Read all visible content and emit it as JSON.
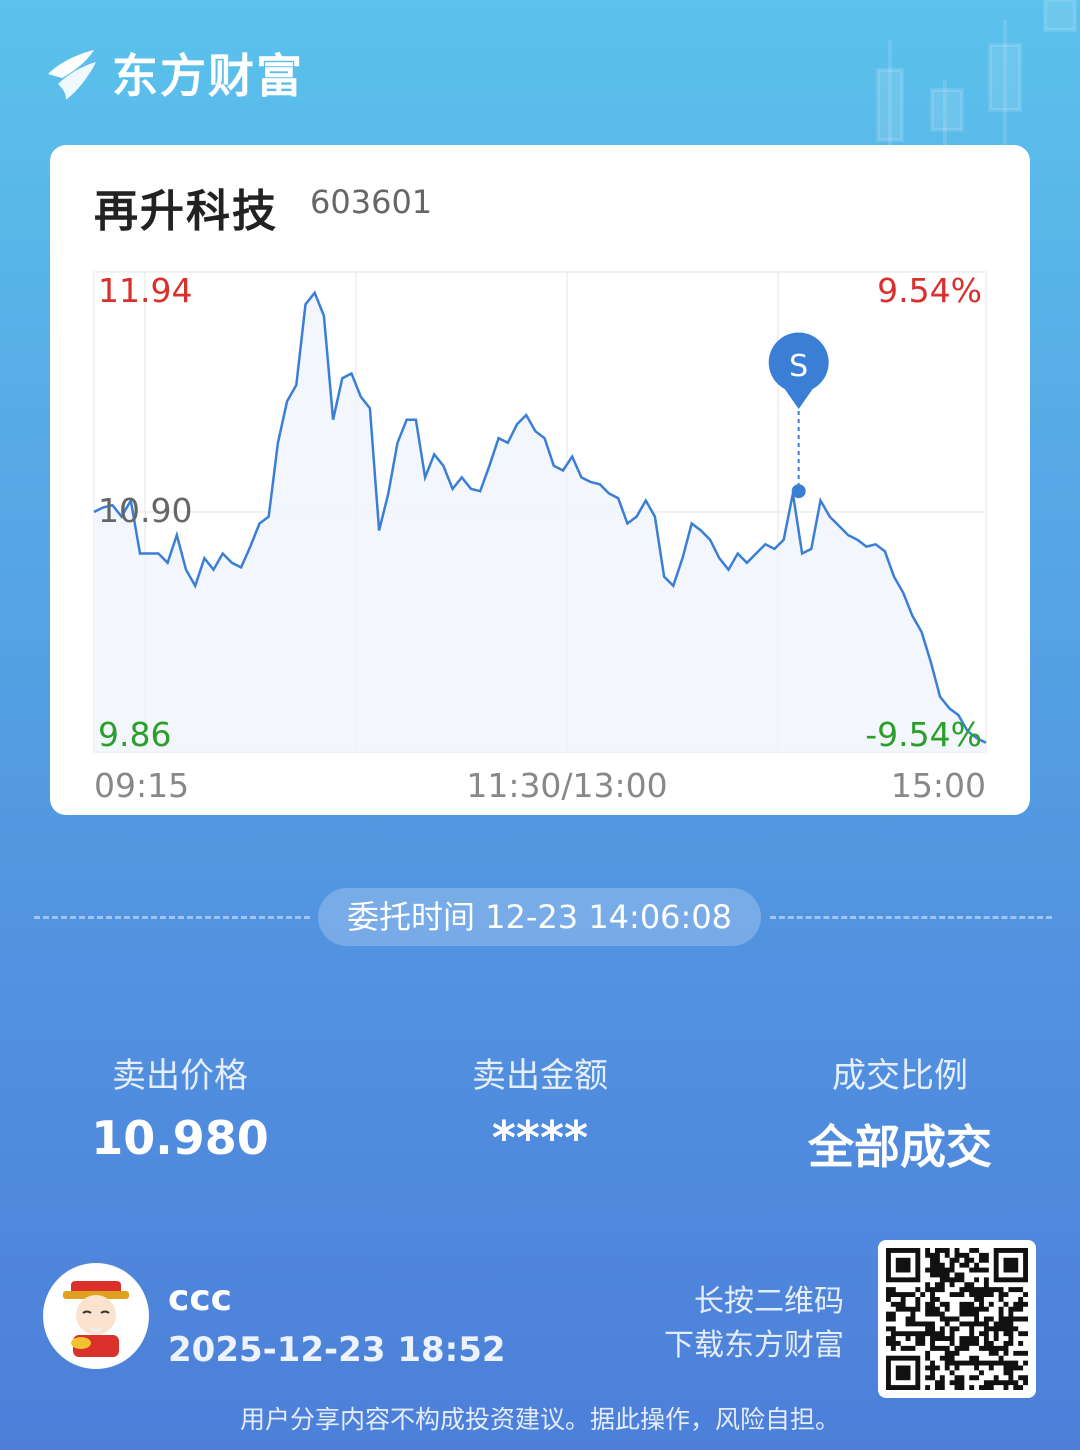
{
  "brand": {
    "name": "东方财富",
    "logo_icon": "eastmoney-logo-icon"
  },
  "stock": {
    "name": "再升科技",
    "code": "603601"
  },
  "chart_data": {
    "type": "line",
    "title": "",
    "xlabel": "",
    "ylabel": "",
    "x_ticks": [
      "09:15",
      "11:30/13:00",
      "15:00"
    ],
    "ylim": [
      9.86,
      11.94
    ],
    "y_labels": {
      "top_price": "11.94",
      "mid_price": "10.90",
      "bottom_price": "9.86",
      "top_pct": "9.54%",
      "bottom_pct": "-9.54%"
    },
    "colors": {
      "line": "#3a7fd5",
      "up": "#d9302c",
      "down": "#2aa02a",
      "neutral": "#666666"
    },
    "grid": true,
    "marker": {
      "label": "S",
      "x": 0.79,
      "y": 10.99
    },
    "series": [
      {
        "values": [
          10.9,
          10.92,
          10.93,
          10.88,
          10.95,
          10.72,
          10.72,
          10.72,
          10.68,
          10.8,
          10.65,
          10.58,
          10.7,
          10.65,
          10.72,
          10.68,
          10.66,
          10.75,
          10.85,
          10.88,
          11.2,
          11.38,
          11.45,
          11.8,
          11.85,
          11.75,
          11.3,
          11.48,
          11.5,
          11.4,
          11.35,
          10.82,
          10.98,
          11.2,
          11.3,
          11.3,
          11.05,
          11.15,
          11.1,
          11.0,
          11.05,
          11.0,
          10.99,
          11.1,
          11.22,
          11.2,
          11.28,
          11.32,
          11.25,
          11.22,
          11.1,
          11.08,
          11.14,
          11.05,
          11.03,
          11.02,
          10.98,
          10.96,
          10.85,
          10.88,
          10.95,
          10.88,
          10.62,
          10.58,
          10.7,
          10.85,
          10.82,
          10.78,
          10.7,
          10.65,
          10.72,
          10.68,
          10.72,
          10.76,
          10.74,
          10.78,
          10.98,
          10.72,
          10.74,
          10.95,
          10.88,
          10.84,
          10.8,
          10.78,
          10.75,
          10.76,
          10.73,
          10.62,
          10.55,
          10.45,
          10.38,
          10.25,
          10.1,
          10.05,
          10.02,
          9.95,
          9.92,
          9.9
        ]
      }
    ]
  },
  "order": {
    "label": "委托时间",
    "value": "12-23 14:06:08"
  },
  "stats": [
    {
      "label": "卖出价格",
      "value": "10.980"
    },
    {
      "label": "卖出金额",
      "value": "****"
    },
    {
      "label": "成交比例",
      "value": "全部成交"
    }
  ],
  "user": {
    "name": "ccc",
    "time": "2025-12-23 18:52",
    "avatar_icon": "god-of-wealth-avatar-icon"
  },
  "qr": {
    "hint_line1": "长按二维码",
    "hint_line2": "下载东方财富",
    "icon": "qr-code-icon"
  },
  "disclaimer": "用户分享内容不构成投资建议。据此操作，风险自担。"
}
